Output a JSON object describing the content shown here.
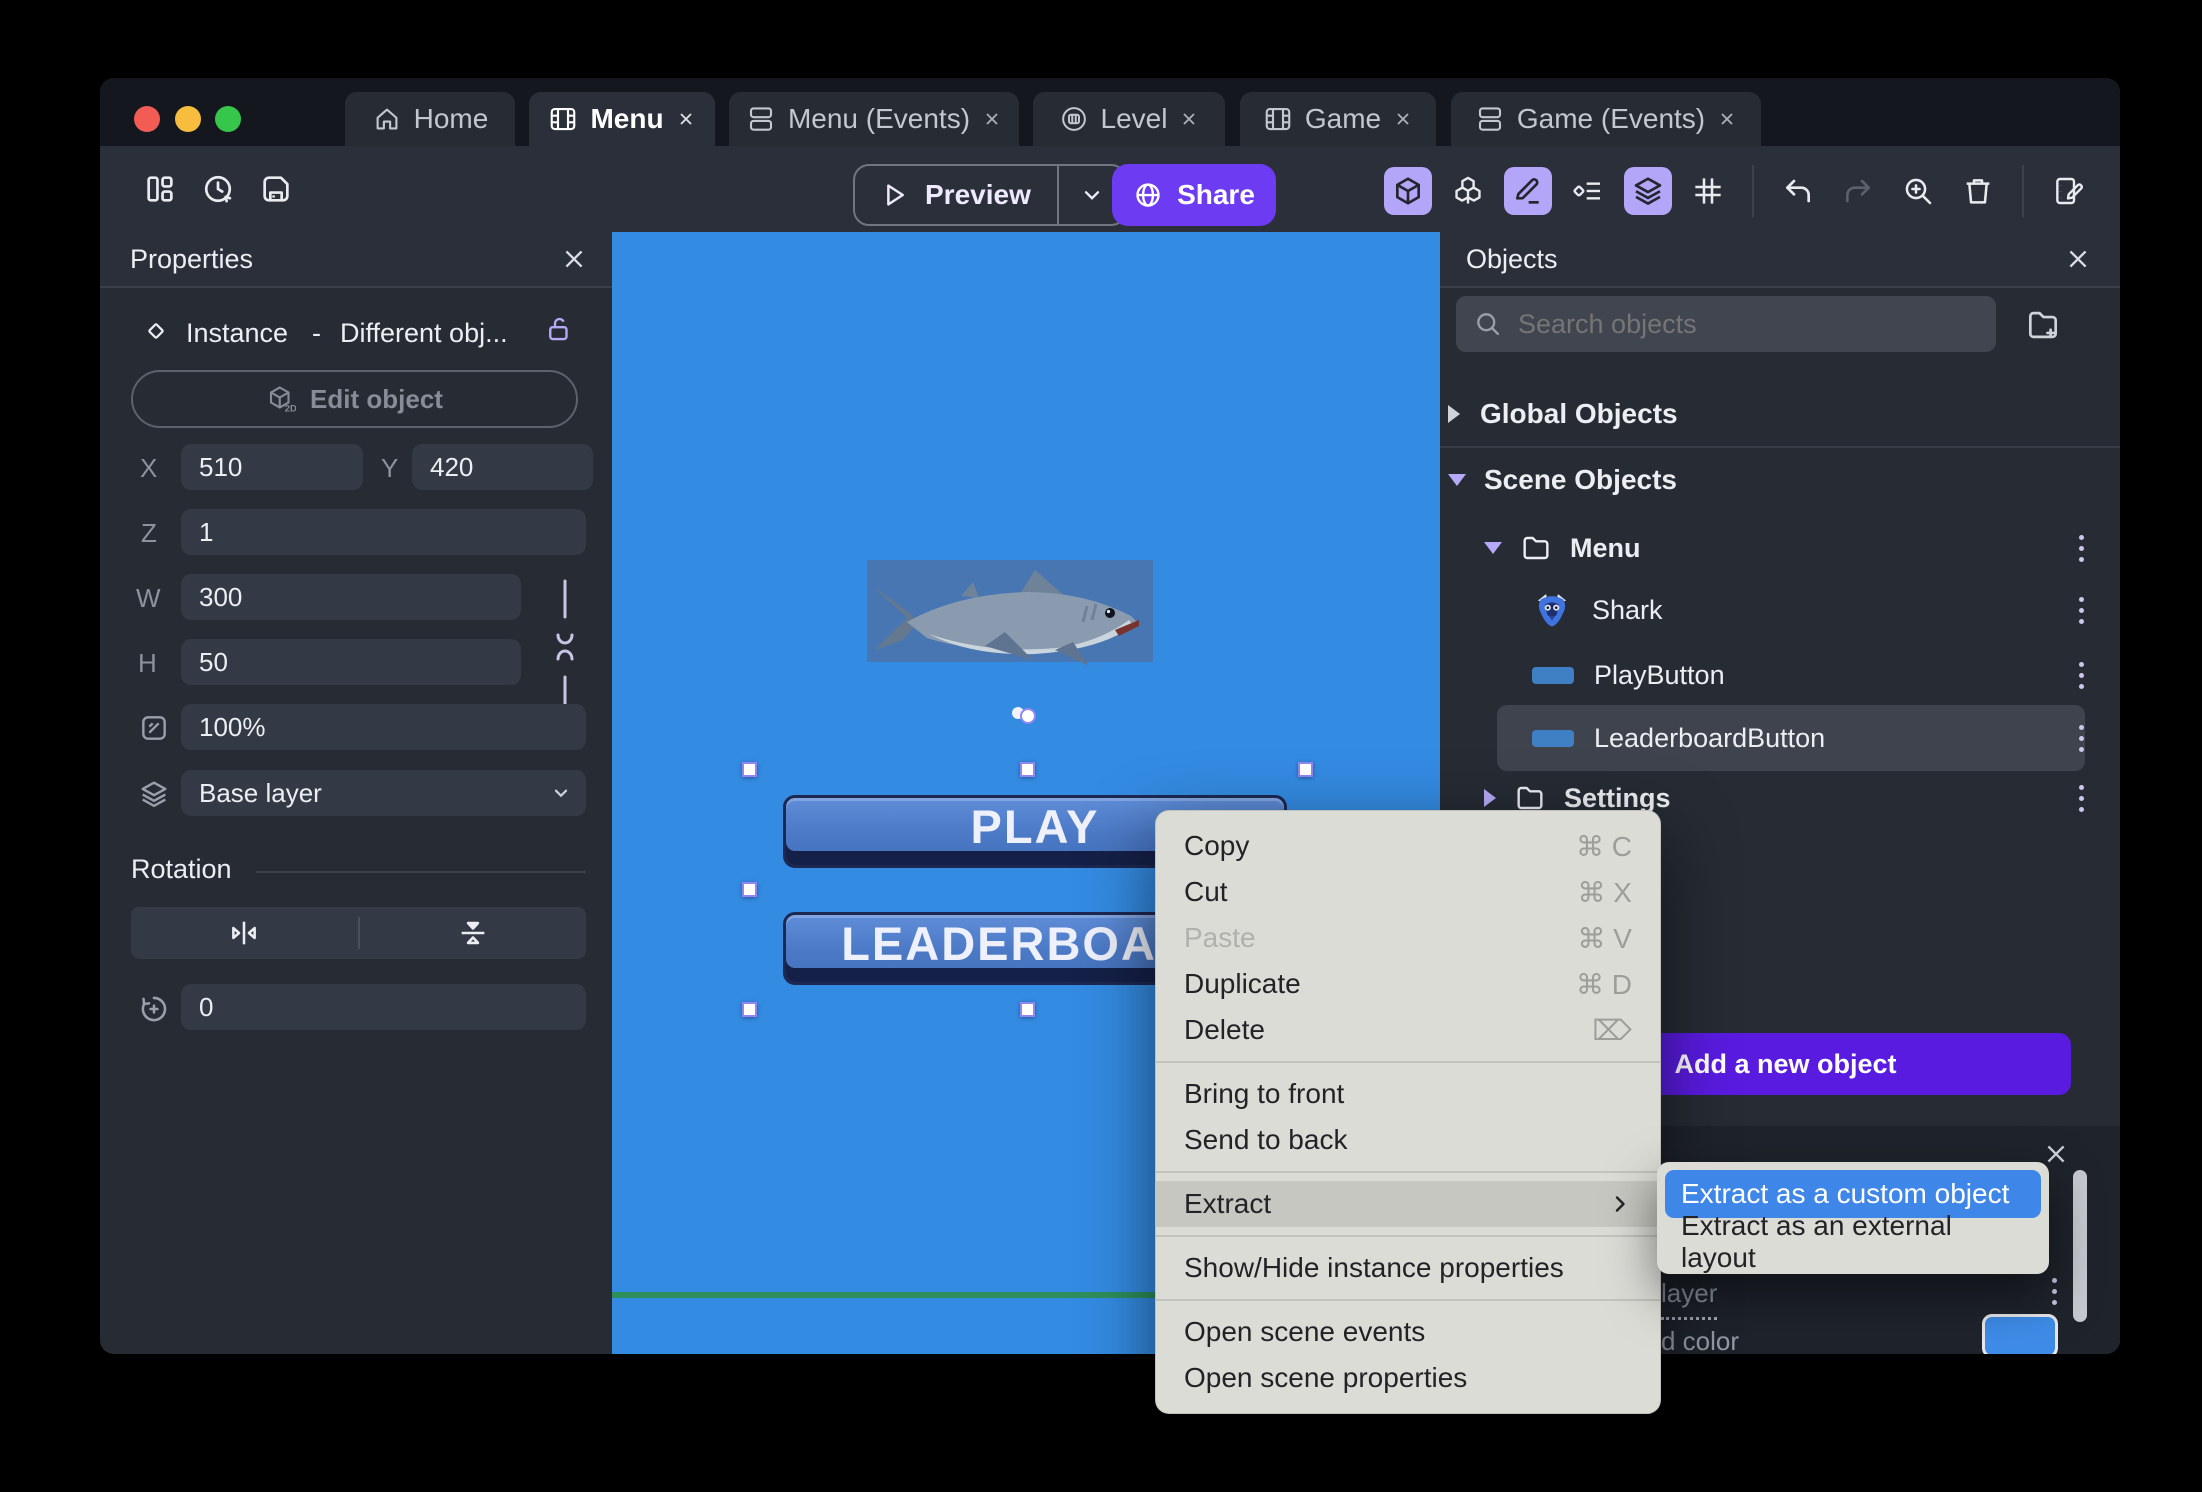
{
  "window_controls": {
    "close_color": "#f25c54",
    "minimize_color": "#f6bd3e",
    "maximize_color": "#35c64b"
  },
  "tabs": [
    {
      "label": "Home",
      "icon": "home-icon",
      "active": false,
      "closable": false
    },
    {
      "label": "Menu",
      "icon": "scene-icon",
      "active": true,
      "closable": true
    },
    {
      "label": "Menu (Events)",
      "icon": "events-icon",
      "active": false,
      "closable": true
    },
    {
      "label": "Level",
      "icon": "level-icon",
      "active": false,
      "closable": true
    },
    {
      "label": "Game",
      "icon": "scene-icon",
      "active": false,
      "closable": true
    },
    {
      "label": "Game (Events)",
      "icon": "events-icon",
      "active": false,
      "closable": true
    }
  ],
  "toolbar": {
    "preview_label": "Preview",
    "share_label": "Share"
  },
  "properties_panel": {
    "title": "Properties",
    "instance_label": "Instance",
    "dash": "-",
    "object_name": "Different obj...",
    "edit_object_label": "Edit object",
    "x_label": "X",
    "x_value": "510",
    "y_label": "Y",
    "y_value": "420",
    "z_label": "Z",
    "z_value": "1",
    "w_label": "W",
    "w_value": "300",
    "h_label": "H",
    "h_value": "50",
    "opacity_value": "100%",
    "layer_value": "Base layer",
    "rotation_title": "Rotation",
    "rotation_value": "0"
  },
  "canvas": {
    "play_button_label": "PLAY",
    "leaderboard_button_label": "LEADERBOARD"
  },
  "objects_panel": {
    "title": "Objects",
    "search_placeholder": "Search objects",
    "global_objects_label": "Global Objects",
    "scene_objects_label": "Scene Objects",
    "menu_folder_label": "Menu",
    "settings_folder_label": "Settings",
    "items": [
      {
        "label": "Shark"
      },
      {
        "label": "PlayButton"
      },
      {
        "label": "LeaderboardButton",
        "selected": true
      }
    ],
    "add_button_label": "Add a new object"
  },
  "context_menu": {
    "copy": {
      "label": "Copy",
      "shortcut": "⌘ C"
    },
    "cut": {
      "label": "Cut",
      "shortcut": "⌘ X"
    },
    "paste": {
      "label": "Paste",
      "shortcut": "⌘ V",
      "disabled": true
    },
    "duplicate": {
      "label": "Duplicate",
      "shortcut": "⌘ D"
    },
    "delete": {
      "label": "Delete",
      "shortcut": "⌦"
    },
    "bring_to_front": {
      "label": "Bring to front"
    },
    "send_to_back": {
      "label": "Send to back"
    },
    "extract": {
      "label": "Extract",
      "highlighted": true
    },
    "show_hide": {
      "label": "Show/Hide instance properties"
    },
    "open_events": {
      "label": "Open scene events"
    },
    "open_properties": {
      "label": "Open scene properties"
    }
  },
  "extract_submenu": {
    "custom_object": "Extract as a custom object",
    "external_layout": "Extract as an external layout"
  },
  "bottom_panel": {
    "layer_text": "layer",
    "color_text": "d color"
  },
  "colors": {
    "canvas_blue": "#348be2",
    "share_purple": "#6c3bf2",
    "add_purple": "#591be0",
    "toggle_active": "#b3a6f8",
    "selection_blue": "#3e86e8"
  }
}
